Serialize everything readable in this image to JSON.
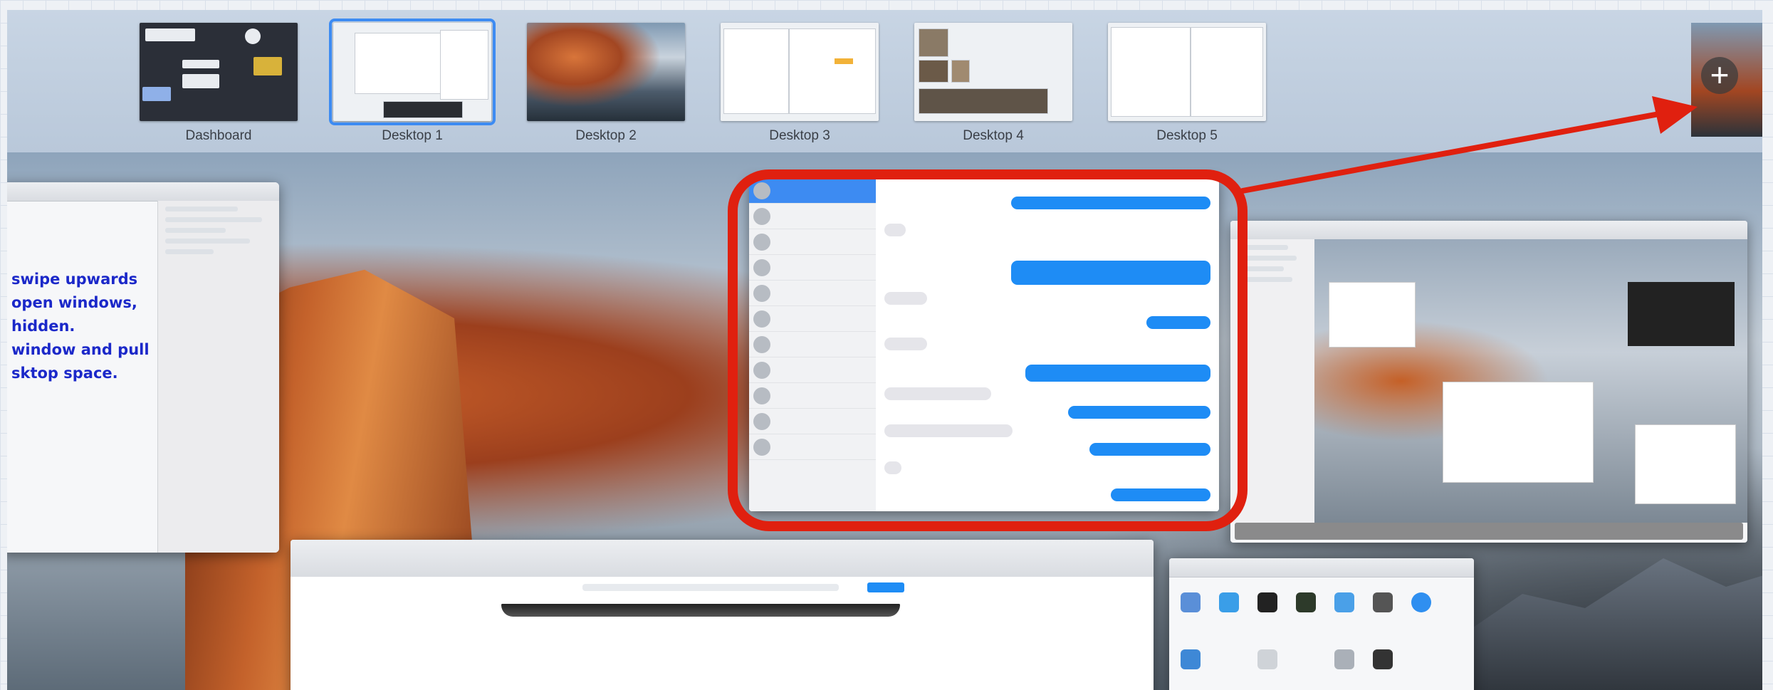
{
  "spaces": [
    {
      "label": "Dashboard",
      "active": false
    },
    {
      "label": "Desktop 1",
      "active": true
    },
    {
      "label": "Desktop 2",
      "active": false
    },
    {
      "label": "Desktop 3",
      "active": false
    },
    {
      "label": "Desktop 4",
      "active": false
    },
    {
      "label": "Desktop 5",
      "active": false
    }
  ],
  "add_space": {
    "icon": "plus-icon",
    "symbol": "+"
  },
  "annotation": {
    "note_text": "swipe upwards\nopen windows,\nhidden.\nwindow and pull\nsktop space.",
    "highlight_color": "#e0200f",
    "arrow_color": "#e0200f"
  },
  "colors": {
    "accent": "#3d8bf2",
    "bubble_out": "#1e8cf5",
    "bubble_in": "#e5e5ea"
  }
}
